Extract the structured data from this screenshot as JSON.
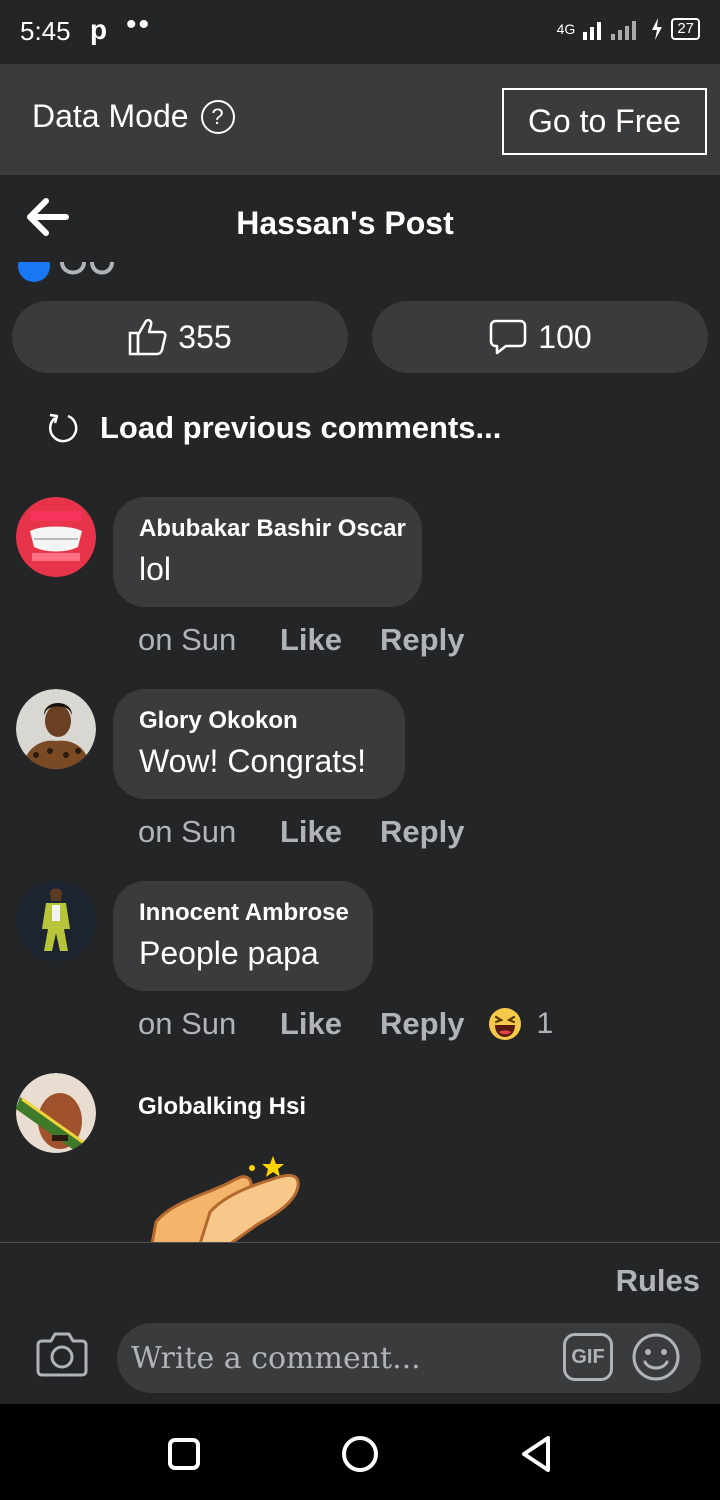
{
  "status": {
    "time": "5:45",
    "app_glyph": "p",
    "dots": "••",
    "network": "4G",
    "battery": "27"
  },
  "datamode": {
    "label": "Data Mode",
    "help": "?",
    "button": "Go to Free"
  },
  "header": {
    "title": "Hassan's Post"
  },
  "stats": {
    "likes": "355",
    "comments": "100"
  },
  "load_previous": "Load previous comments...",
  "comments": [
    {
      "author": "Abubakar Bashir Oscar",
      "text": "lol",
      "time": "on Sun",
      "like": "Like",
      "reply": "Reply"
    },
    {
      "author": "Glory Okokon",
      "text": "Wow! Congrats!",
      "time": "on Sun",
      "like": "Like",
      "reply": "Reply"
    },
    {
      "author": "Innocent Ambrose",
      "text": "People papa",
      "time": "on Sun",
      "like": "Like",
      "reply": "Reply",
      "reaction_count": "1"
    },
    {
      "author": "Globalking Hsi"
    }
  ],
  "composer": {
    "rules": "Rules",
    "placeholder": "Write a comment...",
    "gif": "GIF"
  },
  "colors": {
    "bg": "#242526",
    "surface": "#3a3b3c",
    "muted": "#b0b3b8",
    "accent": "#1877f2"
  },
  "icons": [
    "back-arrow-icon",
    "help-icon",
    "like-thumb-icon",
    "comment-bubble-icon",
    "refresh-icon",
    "laughing-emoji-icon",
    "camera-icon",
    "gif-icon",
    "emoji-icon",
    "nav-square-icon",
    "nav-circle-icon",
    "nav-back-icon"
  ]
}
